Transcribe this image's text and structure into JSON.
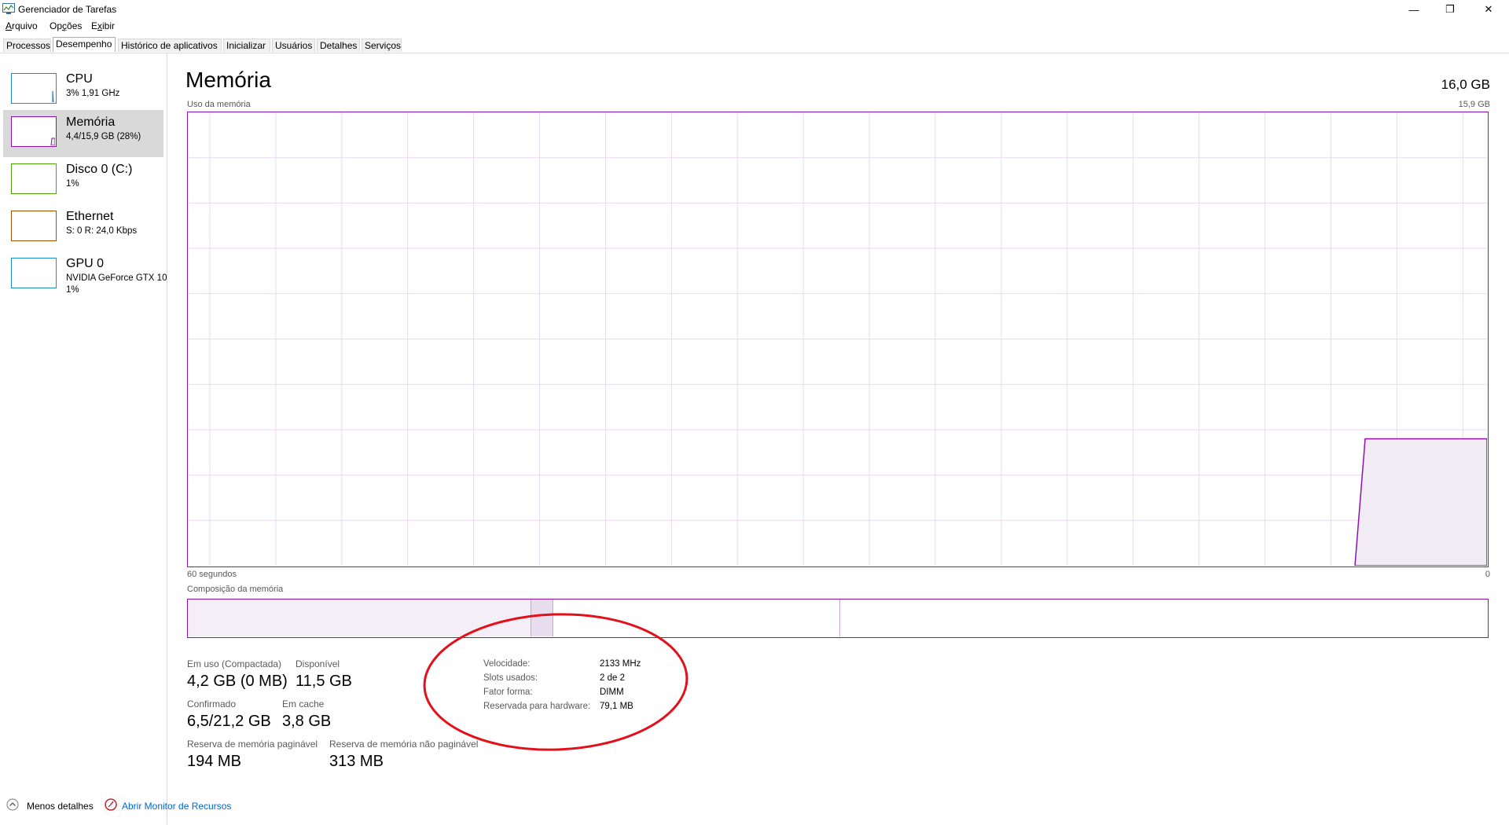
{
  "window": {
    "title": "Gerenciador de Tarefas",
    "controls": {
      "minimize": "—",
      "maximize": "❐",
      "close": "✕"
    }
  },
  "menu": [
    {
      "acc": "A",
      "rest": "rquivo"
    },
    {
      "pre": "Op",
      "acc": "ç",
      "rest": "ões"
    },
    {
      "pre": "E",
      "acc": "x",
      "rest": "ibir"
    }
  ],
  "tabs": [
    "Processos",
    "Desempenho",
    "Histórico de aplicativos",
    "Inicializar",
    "Usuários",
    "Detalhes",
    "Serviços"
  ],
  "sidebar": {
    "items": [
      {
        "title": "CPU",
        "sub": "3%  1,91 GHz",
        "sub2": "",
        "color": "#1c8ec9"
      },
      {
        "title": "Memória",
        "sub": "4,4/15,9 GB (28%)",
        "sub2": "",
        "color": "#8b12ae"
      },
      {
        "title": "Disco 0 (C:)",
        "sub": "1%",
        "sub2": "",
        "color": "#4da60c"
      },
      {
        "title": "Ethernet",
        "sub": "S: 0  R: 24,0 Kbps",
        "sub2": "",
        "color": "#a74f01"
      },
      {
        "title": "GPU 0",
        "sub": "NVIDIA GeForce GTX 10",
        "sub2": "1%",
        "color": "#1c8ec9"
      }
    ]
  },
  "main": {
    "title": "Memória",
    "total": "16,0 GB",
    "usage_label": "Uso da memória",
    "usage_max": "15,9 GB",
    "time_left": "60 segundos",
    "time_right": "0",
    "composition_label": "Composição da memória",
    "usage_fraction": 0.28,
    "stats": {
      "in_use_label": "Em uso (Compactada)",
      "in_use": "4,2 GB (0 MB)",
      "available_label": "Disponível",
      "available": "11,5 GB",
      "committed_label": "Confirmado",
      "committed": "6,5/21,2 GB",
      "cached_label": "Em cache",
      "cached": "3,8 GB",
      "paged_label": "Reserva de memória paginável",
      "paged": "194 MB",
      "nonpaged_label": "Reserva de memória não paginável",
      "nonpaged": "313 MB"
    },
    "details": [
      {
        "label": "Velocidade:",
        "value": "2133 MHz"
      },
      {
        "label": "Slots usados:",
        "value": "2 de 2"
      },
      {
        "label": "Fator forma:",
        "value": "DIMM"
      },
      {
        "label": "Reservada para hardware:",
        "value": "79,1 MB"
      }
    ],
    "accent": "#8b12ae",
    "highlight_color": "#e3101b"
  },
  "footer": {
    "less_details": "Menos detalhes",
    "resource_monitor": "Abrir Monitor de Recursos"
  }
}
